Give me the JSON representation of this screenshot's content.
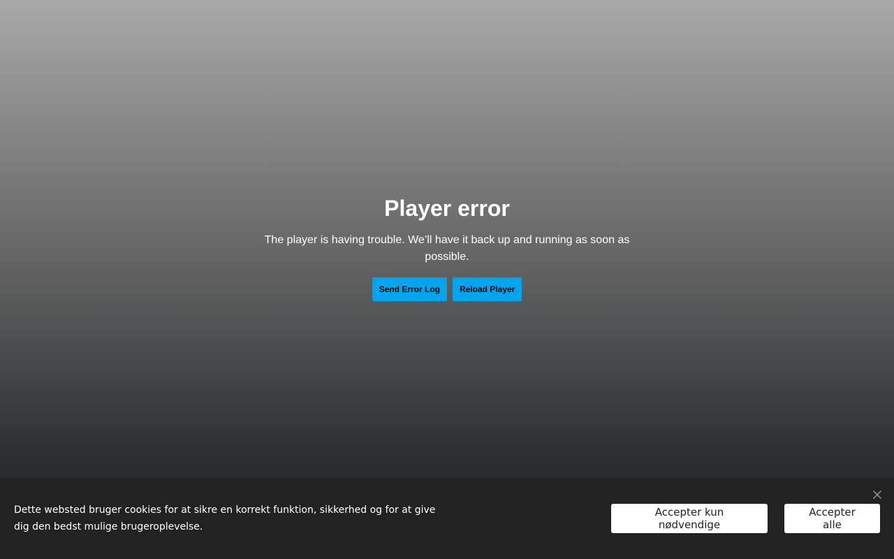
{
  "player_error": {
    "title": "Player error",
    "message": "The player is having trouble. We’ll have it back up and running as soon as possible.",
    "buttons": {
      "send_error_log": "Send Error Log",
      "reload_player": "Reload Player"
    }
  },
  "cookie_banner": {
    "text": "Dette websted bruger cookies for at sikre en korrekt funktion, sikkerhed og for at give dig den bedst mulige brugeroplevelse.",
    "accept_necessary": "Accepter kun nødvendige",
    "accept_all": "Accepter alle",
    "close_icon": "close-icon"
  },
  "colors": {
    "error_button_bg": "#00a5ef",
    "cookie_bar_bg": "#222223",
    "cookie_button_bg": "#ffffff"
  }
}
